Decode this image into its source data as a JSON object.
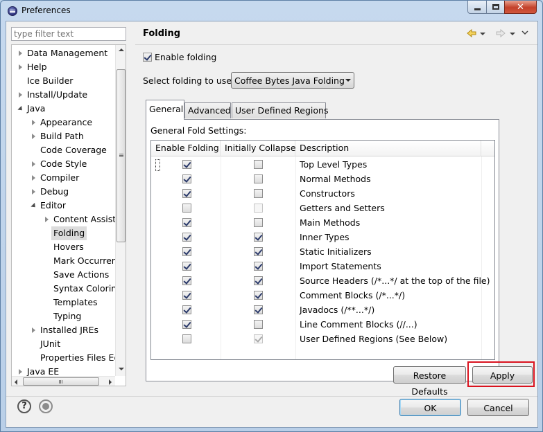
{
  "window": {
    "title": "Preferences",
    "minimize": "minimize",
    "maximize": "maximize",
    "close": "✕"
  },
  "filter": {
    "placeholder": "type filter text"
  },
  "tree": {
    "items": [
      {
        "label": "Data Management",
        "level": 0,
        "state": "collapsed"
      },
      {
        "label": "Help",
        "level": 0,
        "state": "collapsed"
      },
      {
        "label": "Ice Builder",
        "level": 0,
        "state": "leaf"
      },
      {
        "label": "Install/Update",
        "level": 0,
        "state": "collapsed"
      },
      {
        "label": "Java",
        "level": 0,
        "state": "expanded"
      },
      {
        "label": "Appearance",
        "level": 1,
        "state": "collapsed"
      },
      {
        "label": "Build Path",
        "level": 1,
        "state": "collapsed"
      },
      {
        "label": "Code Coverage",
        "level": 1,
        "state": "leaf"
      },
      {
        "label": "Code Style",
        "level": 1,
        "state": "collapsed"
      },
      {
        "label": "Compiler",
        "level": 1,
        "state": "collapsed"
      },
      {
        "label": "Debug",
        "level": 1,
        "state": "collapsed"
      },
      {
        "label": "Editor",
        "level": 1,
        "state": "expanded"
      },
      {
        "label": "Content Assist",
        "level": 2,
        "state": "collapsed"
      },
      {
        "label": "Folding",
        "level": 2,
        "state": "leaf",
        "selected": true
      },
      {
        "label": "Hovers",
        "level": 2,
        "state": "leaf"
      },
      {
        "label": "Mark Occurrences",
        "level": 2,
        "state": "leaf"
      },
      {
        "label": "Save Actions",
        "level": 2,
        "state": "leaf"
      },
      {
        "label": "Syntax Coloring",
        "level": 2,
        "state": "leaf"
      },
      {
        "label": "Templates",
        "level": 2,
        "state": "leaf"
      },
      {
        "label": "Typing",
        "level": 2,
        "state": "leaf"
      },
      {
        "label": "Installed JREs",
        "level": 1,
        "state": "collapsed"
      },
      {
        "label": "JUnit",
        "level": 1,
        "state": "leaf"
      },
      {
        "label": "Properties Files Editor",
        "level": 1,
        "state": "leaf"
      },
      {
        "label": "Java EE",
        "level": 0,
        "state": "collapsed"
      }
    ]
  },
  "page": {
    "title": "Folding",
    "enable_folding": {
      "label": "Enable folding",
      "checked": true
    },
    "select_label": "Select folding to use:",
    "select_value": "Coffee Bytes Java Folding",
    "tabs": [
      "General",
      "Advanced",
      "User Defined Regions"
    ],
    "active_tab": 0,
    "group_label": "General Fold Settings:",
    "columns": [
      "Enable Folding",
      "Initially Collapse",
      "Description"
    ],
    "rows": [
      {
        "enable": true,
        "collapse": false,
        "collapse_enabled": true,
        "description": "Top Level Types"
      },
      {
        "enable": true,
        "collapse": false,
        "collapse_enabled": true,
        "description": "Normal Methods"
      },
      {
        "enable": true,
        "collapse": false,
        "collapse_enabled": true,
        "description": "Constructors"
      },
      {
        "enable": false,
        "collapse": false,
        "collapse_enabled": false,
        "description": "Getters and Setters"
      },
      {
        "enable": true,
        "collapse": false,
        "collapse_enabled": true,
        "description": "Main Methods"
      },
      {
        "enable": true,
        "collapse": true,
        "collapse_enabled": true,
        "description": "Inner Types"
      },
      {
        "enable": true,
        "collapse": true,
        "collapse_enabled": true,
        "description": "Static Initializers"
      },
      {
        "enable": true,
        "collapse": true,
        "collapse_enabled": true,
        "description": "Import Statements"
      },
      {
        "enable": true,
        "collapse": true,
        "collapse_enabled": true,
        "description": "Source Headers (/*...*/ at the top of the file)"
      },
      {
        "enable": true,
        "collapse": true,
        "collapse_enabled": true,
        "description": "Comment Blocks (/*...*/)"
      },
      {
        "enable": true,
        "collapse": true,
        "collapse_enabled": true,
        "description": "Javadocs (/**...*/)"
      },
      {
        "enable": true,
        "collapse": false,
        "collapse_enabled": true,
        "description": "Line Comment Blocks (//...)"
      },
      {
        "enable": false,
        "collapse": true,
        "collapse_enabled": false,
        "description": "User Defined Regions (See Below)"
      }
    ],
    "restore_defaults": "Restore Defaults",
    "apply": "Apply"
  },
  "footer": {
    "help": "?",
    "ok": "OK",
    "cancel": "Cancel"
  },
  "colors": {
    "highlight": "#d9121e",
    "title_bar": "#c6d9ee",
    "close_button": "#c3402a"
  }
}
